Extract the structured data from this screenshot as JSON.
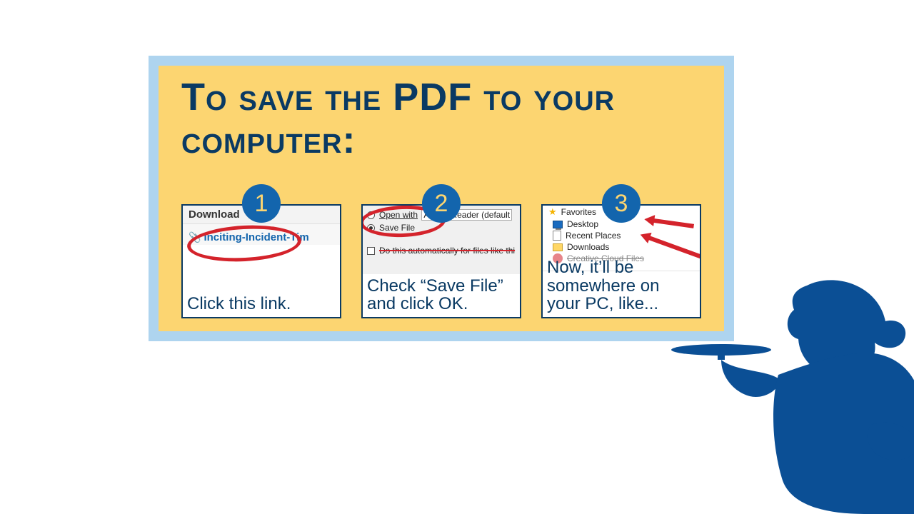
{
  "title": "To save the PDF to your computer:",
  "steps": {
    "s1": {
      "num": "1",
      "header": "Download",
      "link_text": "Inciting-Incident-Tim",
      "caption": "Click this link."
    },
    "s2": {
      "num": "2",
      "open_with_label": "Open with",
      "open_with_app": "Adobe Reader  (default",
      "save_file_label": "Save File",
      "auto_label": "Do this automatically for files like thi",
      "caption": "Check “Save File” and click OK."
    },
    "s3": {
      "num": "3",
      "favorites": "Favorites",
      "desktop": "Desktop",
      "recent": "Recent Places",
      "downloads": "Downloads",
      "ccfiles": "Creative Cloud Files",
      "caption": "Now, it’ll be somewhere on your PC, like..."
    }
  }
}
